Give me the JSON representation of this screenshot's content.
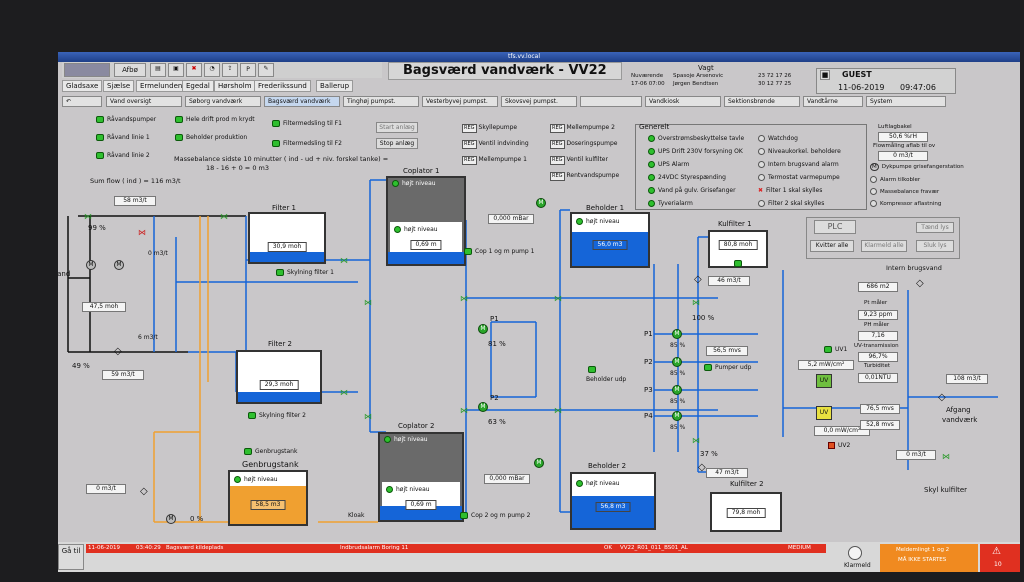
{
  "window_title": "tfs.vv.local",
  "toolbar": {
    "afbrud": "Afbø",
    "p_label": "P"
  },
  "nav_tabs": [
    "Gladsaxe",
    "Sjælse",
    "Ermelunden",
    "Egedal",
    "Hørsholm",
    "Frederikssund",
    "Ballerup"
  ],
  "page_title": "Bagsværd vandværk - VV22",
  "vagt": {
    "label": "Vagt",
    "nuvaerende_label": "Nuværende",
    "nuvaerende_date": "17-06 07:00",
    "name1": "Spasoje Arsenovic",
    "name2": "Jørgen Bendtsen",
    "phone1": "23 72 17 26",
    "phone2": "30 12 77 25"
  },
  "user": "GUEST",
  "date": "11-06-2019",
  "time": "09:47:06",
  "menus": [
    "Vand oversigt",
    "Søborg vandværk",
    "Bagsværd vandværk",
    "Tinghøj pumpst.",
    "Vesterbyvej pumpst.",
    "Skovsvej pumpst.",
    "Vandkiosk",
    "Sektionsbrønde",
    "Vandtårne",
    "System"
  ],
  "back_arrow": "↶",
  "legend_left": [
    "Råvandspumper",
    "Råvand linie 1",
    "Råvand linie 2"
  ],
  "legend_mid": [
    "Hele drift prod m krydt",
    "Beholder produktion"
  ],
  "legend_right": [
    "Filtermedsling til F1",
    "Filtermedsling til F2"
  ],
  "start_anlaeg": "Start anlæg",
  "stop_anlaeg": "Stop anlæg",
  "masse_label": "Massebalance sidste 10 minutter ( ind - ud + niv. forskel tanke) =",
  "masse_values": "18  -  16  +  0  =  0 m3",
  "sum_flow": "Sum flow ( ind ) = 116 m3/t",
  "reg_buttons": {
    "reg": "REG",
    "col1": [
      "Skyllepumpe",
      "Ventil indvinding",
      "Mellempumpe 1"
    ],
    "col2": [
      "Mellempumpe 2",
      "Doseringspumpe",
      "Ventil kulfilter",
      "Rentvandspumpe"
    ]
  },
  "generelt": {
    "title": "Generelt",
    "left": [
      "Overstrømsbeskyttelse tavle",
      "UPS Drift 230V forsyning OK",
      "UPS Alarm",
      "24VDC Styrespænding",
      "Vand på gulv. Grisefanger",
      "Tyverialarm"
    ],
    "right": [
      "Watchdog",
      "Niveaukorkel. beholdere",
      "Intern brugsvand alarm",
      "Termostat varmepumpe",
      "Filter 1 skal skylles",
      "Filter 2 skal skylles"
    ]
  },
  "right_panel": {
    "luftlag_label": "Luftlagbakel",
    "luftlag_val": "50,6 %rH",
    "flow_label": "Flowmåling aflab til ov",
    "flow_val": "0 m3/t",
    "items": [
      "Dykpumpe grisefangerstation",
      "Alarm tilkobler",
      "Massebalance fravær",
      "Kompressor aflastning"
    ],
    "plc": "PLC",
    "tend_lys": "Tænd lys",
    "kvitter_alle": "Kvitter alle",
    "klarmeld_alle": "Klarmeld alle",
    "sluk_lys": "Sluk lys"
  },
  "plant": {
    "ravand": "Råvand",
    "flow_top": "58 m3/t",
    "pct_top": "99 %",
    "flow_zero": "0 m3/t",
    "level_raw": "47,5 moh",
    "flow_p6": "6 m3/t",
    "pct_bottom": "49 %",
    "flow_bottom": "59 m3/t",
    "filter1": {
      "name": "Filter 1",
      "level": "30,9 moh",
      "skyl": "Skylning filter 1"
    },
    "filter2": {
      "name": "Filter 2",
      "level": "29,3 moh",
      "skyl": "Skylning filter 2"
    },
    "coplator1": {
      "name": "Coplator 1",
      "hojt": "højt niveau",
      "level": "0,69 m",
      "pump": "Cop 1 og m pump 1",
      "pressure": "0,000 mBar"
    },
    "coplator2": {
      "name": "Coplator 2",
      "hojt": "højt niveau",
      "level": "0,69 m",
      "pump": "Cop 2 og m pump 2",
      "pressure": "0,000 mBar"
    },
    "genbrug": {
      "label": "Genbrugstank",
      "name": "Genbrugstank",
      "hojt": "højt niveau",
      "level": "58,5 m3",
      "flow": "0 m3/t",
      "pct": "0 %",
      "kloak": "Kloak"
    },
    "p1": {
      "name": "P1",
      "pct": "81 %"
    },
    "p2": {
      "name": "P2",
      "pct": "63 %"
    },
    "beholder1": {
      "name": "Beholder 1",
      "hojt": "højt niveau",
      "level": "56,0 m3"
    },
    "beholder2": {
      "name": "Beholder 2",
      "hojt": "højt niveau",
      "level": "56,8 m3"
    },
    "beholder_udp": "Beholder udp",
    "pumps": [
      {
        "name": "P1",
        "pct": "85 %"
      },
      {
        "name": "P2",
        "pct": "85 %"
      },
      {
        "name": "P3",
        "pct": "85 %"
      },
      {
        "name": "P4",
        "pct": "85 %"
      }
    ],
    "pumper_udp": "Pumper udp",
    "mvs": "56,5 mvs",
    "kulfilter1": {
      "name": "Kulfilter 1",
      "level": "80,8 moh",
      "flow": "46 m3/t",
      "pct": "100 %"
    },
    "kulfilter2": {
      "name": "Kulfilter 2",
      "level": "79,8 moh",
      "flow": "47 m3/t",
      "pct": "37 %"
    },
    "uv": {
      "uv1": "UV1",
      "uv2": "UV2",
      "uv_label": "UV",
      "val1": "5,2 mW/cm²",
      "val2": "0,0 mW/cm²"
    },
    "intern": {
      "label": "Intern brugsvand",
      "val": "686 m2"
    },
    "quality": {
      "pt_label": "Pt måler",
      "pt": "9,23 ppm",
      "ph_label": "PH måler",
      "ph": "7,16",
      "uvt_label": "UV-transmission",
      "uvt": "96,7%",
      "turb_label": "Turbiditet",
      "turb": "0,01NTU"
    },
    "mvs2": "76,5 mvs",
    "mvs3": "52,8 mvs",
    "afgang": {
      "label1": "Afgang",
      "label2": "vandværk",
      "flow": "108 m3/t"
    },
    "skyl_kul": {
      "label": "Skyl kulfilter",
      "flow": "0 m3/t"
    }
  },
  "statusbar": {
    "ga_til": "Gå til",
    "alarm_date": "11-06-2019",
    "alarm_time": "03:40:29",
    "alarm_place": "Bagsværd kildeplads",
    "alarm_text": "Indbrudsalarm Boring 11",
    "alarm_ok": "OK",
    "alarm_tag": "VV22_R01_011_BS01_AL",
    "alarm_level": "MEDIUM",
    "klarmeld": "Klarmeld",
    "alarm_summary1": "Meldemlingt 1 og 2",
    "alarm_summary2": "MÅ IKKE STARTES",
    "alarm_count": "10"
  },
  "colors": {
    "water": "#1565d8",
    "orange_pipe": "#f0a030",
    "ok_lamp": "#2ec02e",
    "alarm_red": "#e03020"
  }
}
